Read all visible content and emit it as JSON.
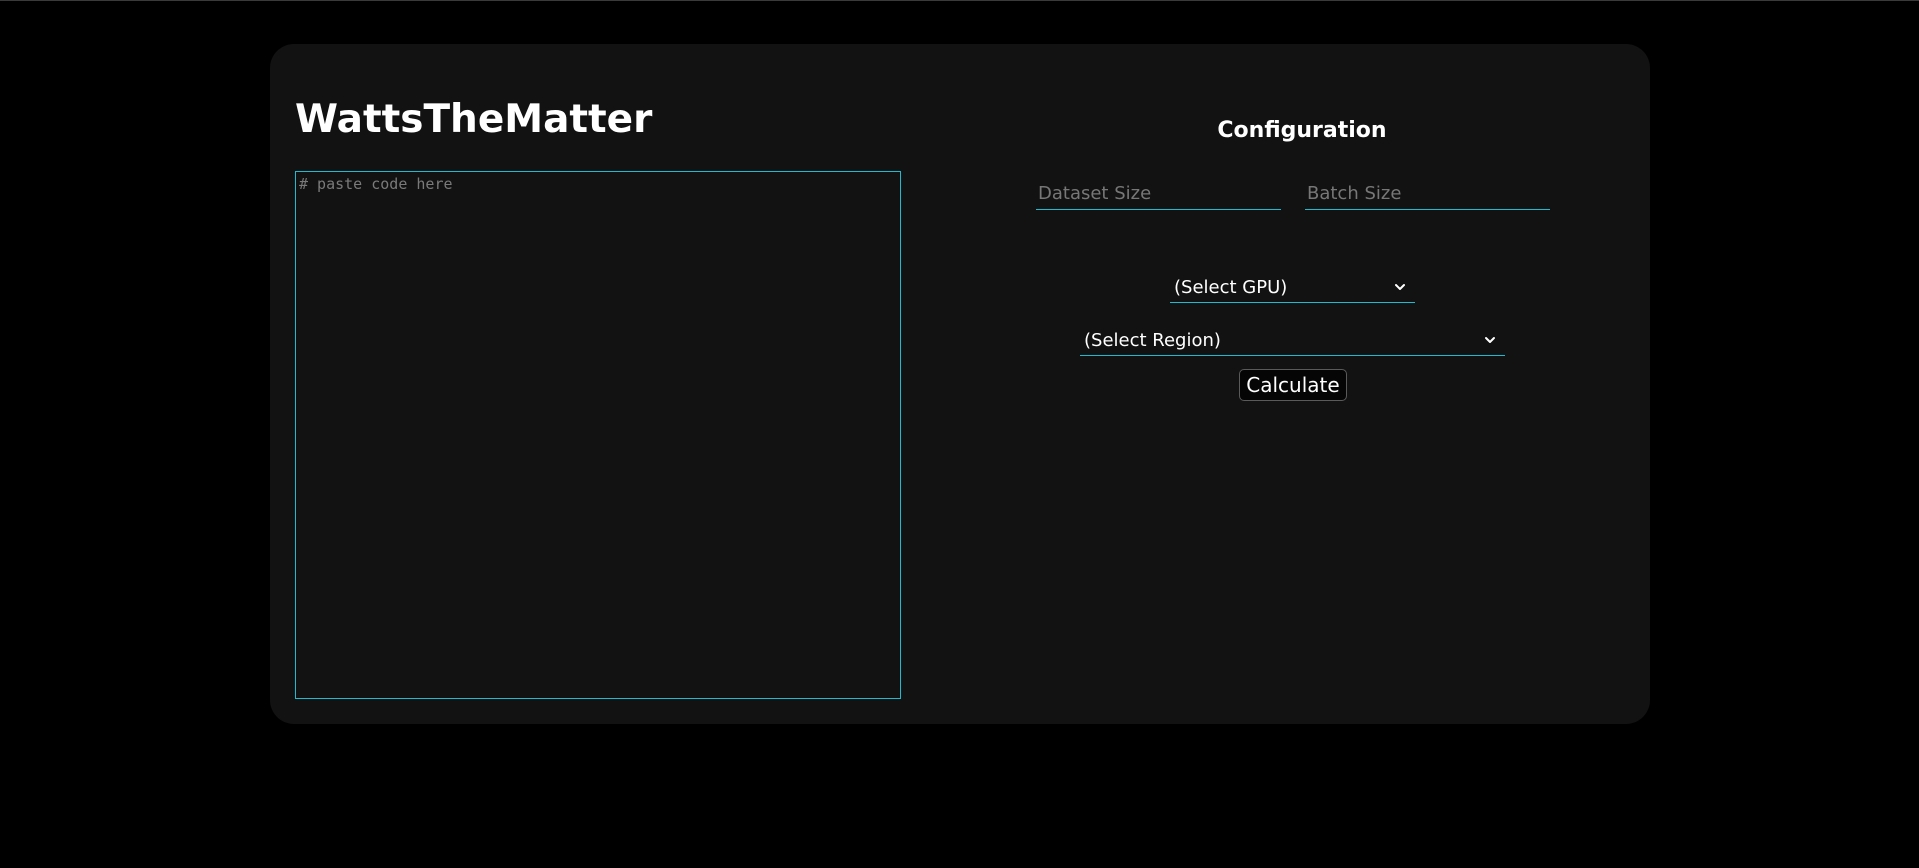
{
  "app": {
    "title": "WattsTheMatter"
  },
  "editor": {
    "placeholder": "# paste code here",
    "value": ""
  },
  "config": {
    "title": "Configuration",
    "dataset_size_placeholder": "Dataset Size",
    "batch_size_placeholder": "Batch Size",
    "gpu_select": {
      "selected": "(Select GPU)",
      "icon": "chevron-down-icon"
    },
    "region_select": {
      "selected": "(Select Region)",
      "icon": "chevron-down-icon"
    },
    "calculate_label": "Calculate"
  },
  "colors": {
    "page_background": "#000000",
    "card_background": "#121212",
    "accent": "#1ebad0",
    "text": "#ffffff",
    "placeholder": "#777777"
  }
}
